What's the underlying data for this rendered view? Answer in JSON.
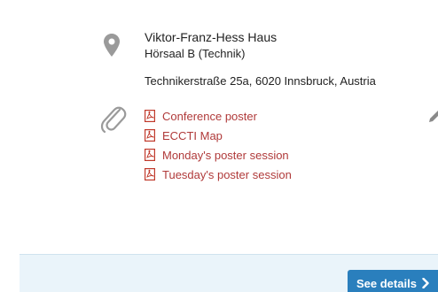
{
  "location": {
    "icon": "map-pin-icon",
    "venue_name": "Viktor-Franz-Hess Haus",
    "room": "Hörsaal B (Technik)",
    "address": "Technikerstraße 25a, 6020 Innsbruck, Austria"
  },
  "attachments": {
    "icon": "paperclip-icon",
    "file_icon": "pdf-file-icon",
    "link_color": "#b03a3a",
    "items": [
      {
        "label": "Conference poster"
      },
      {
        "label": "ECCTI Map"
      },
      {
        "label": "Monday's poster session"
      },
      {
        "label": "Tuesday's poster session"
      }
    ]
  },
  "edit_icon": "pencil-icon",
  "footer": {
    "background": "#eaf4fa",
    "details_button_label": "See details",
    "details_button_color": "#2a7fbd",
    "details_button_icon": "chevron-right-icon"
  }
}
